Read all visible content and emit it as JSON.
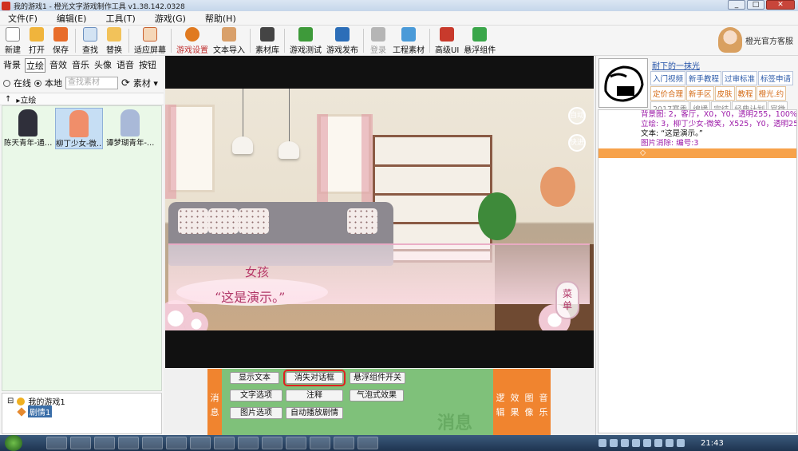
{
  "window": {
    "title": "我的游戏1 - 橙光文字游戏制作工具 v1.38.142.0328"
  },
  "menu": [
    "文件(F)",
    "编辑(E)",
    "工具(T)",
    "游戏(G)",
    "帮助(H)"
  ],
  "toolbar": {
    "new": "新建",
    "open": "打开",
    "save": "保存",
    "find": "查找",
    "replace": "替换",
    "fit_screen": "适应屏幕",
    "game_settings": "游戏设置",
    "text_import": "文本导入",
    "library": "素材库",
    "test_game": "游戏测试",
    "publish": "游戏发布",
    "login": "登录",
    "project_assets": "工程素材",
    "advanced_ui": "高级UI",
    "floating_components": "悬浮组件",
    "helpdesk": "橙光官方客服"
  },
  "left": {
    "tabs": [
      "背景",
      "立绘",
      "音效",
      "音乐",
      "头像",
      "语音",
      "按钮"
    ],
    "active_tab": "立绘",
    "source_online": "在线",
    "source_local": "本地",
    "search_placeholder": "查找素材",
    "assets_label": "素材",
    "path_up": "↑",
    "path": "▸立绘",
    "characters": [
      {
        "name": "陈天青年-通…",
        "color": "#2f2f3a"
      },
      {
        "name": "柳丁少女-微…",
        "color": "#f08e6a"
      },
      {
        "name": "谭梦瑚青年-…",
        "color": "#a9b9d8"
      }
    ],
    "tree": {
      "game": "我的游戏1",
      "chapter": "剧情1"
    }
  },
  "preview": {
    "speaker": "女孩",
    "dialog": "“这是演示。”",
    "side_buttons": [
      "自动",
      "快进"
    ],
    "menu_badge": [
      "菜",
      "单"
    ]
  },
  "right": {
    "username": "耐下的一抹光",
    "tags": [
      {
        "t": "入门视频",
        "c": "b"
      },
      {
        "t": "新手教程",
        "c": "b"
      },
      {
        "t": "过审标准",
        "c": "b"
      },
      {
        "t": "标签申请",
        "c": "b"
      },
      {
        "t": "定价合理",
        "c": "o"
      },
      {
        "t": "新手区",
        "c": "o"
      },
      {
        "t": "皮肤",
        "c": "o"
      },
      {
        "t": "教程",
        "c": "o"
      },
      {
        "t": "橙光.约",
        "c": "o"
      },
      {
        "t": "2017赛季",
        "c": "g"
      },
      {
        "t": "编播",
        "c": "g"
      },
      {
        "t": "完结",
        "c": "g"
      },
      {
        "t": "经典计划",
        "c": "g"
      },
      {
        "t": "官微",
        "c": "g"
      }
    ],
    "script": [
      {
        "t": "背景图: 2，客厅，X0，Y0，透明255，100%，10",
        "k": "p"
      },
      {
        "t": "立绘: 3，柳丁少女-微笑，X525，Y0，透明255",
        "k": "p"
      },
      {
        "t": "文本: “这是演示。”",
        "k": "k"
      },
      {
        "t": "图片消除: 编号:3",
        "k": "p"
      },
      {
        "t": "◇",
        "k": "cur"
      }
    ]
  },
  "bottom": {
    "tab_message": "消息",
    "tabs_right": [
      "逻辑",
      "效果",
      "图像",
      "音乐"
    ],
    "buttons": {
      "show_text": "显示文本",
      "hide_dialog": "消失对话框",
      "floating_toggle": "悬浮组件开关",
      "text_options": "文字选项",
      "comment": "注释",
      "bubble": "气泡式效果",
      "image_options": "图片选项",
      "auto_play": "自动播放剧情"
    },
    "watermark": "消息"
  },
  "taskbar": {
    "clock": "21:43"
  }
}
